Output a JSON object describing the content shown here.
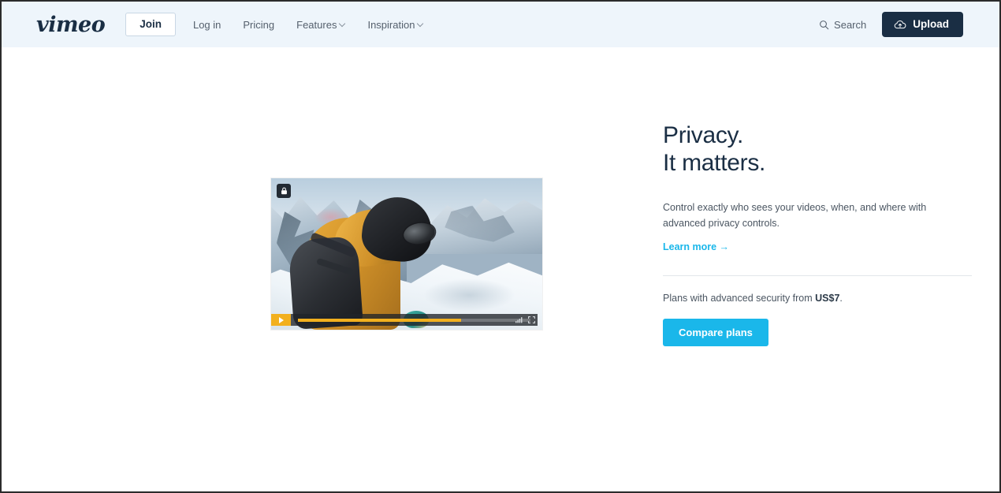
{
  "header": {
    "logo_text": "vimeo",
    "join_label": "Join",
    "nav": [
      {
        "label": "Log in",
        "has_chevron": false
      },
      {
        "label": "Pricing",
        "has_chevron": false
      },
      {
        "label": "Features",
        "has_chevron": true
      },
      {
        "label": "Inspiration",
        "has_chevron": true
      }
    ],
    "search_label": "Search",
    "upload_label": "Upload",
    "background_color": "#eef5fb",
    "upload_button_color": "#1a2e44"
  },
  "player": {
    "lock_badge_icon": "padlock-icon",
    "play_icon": "play-icon",
    "play_button_color": "#f2b01e",
    "progress_percent": 70,
    "progress_fill_color": "#f2b01e",
    "quality_icon": "signal-bars-icon",
    "fullscreen_icon": "fullscreen-icon",
    "scene_description": "snowboarder in yellow jacket on snowy mountain"
  },
  "content": {
    "headline_line1": "Privacy.",
    "headline_line2": "It matters.",
    "body": "Control exactly who sees your videos, when, and where with advanced privacy controls.",
    "learn_more_label": "Learn more →",
    "plans_prefix": "Plans with advanced security from ",
    "plans_price": "US$7",
    "plans_suffix": ".",
    "compare_label": "Compare plans",
    "accent_color": "#1ab7ea",
    "heading_color": "#1a2e44"
  }
}
